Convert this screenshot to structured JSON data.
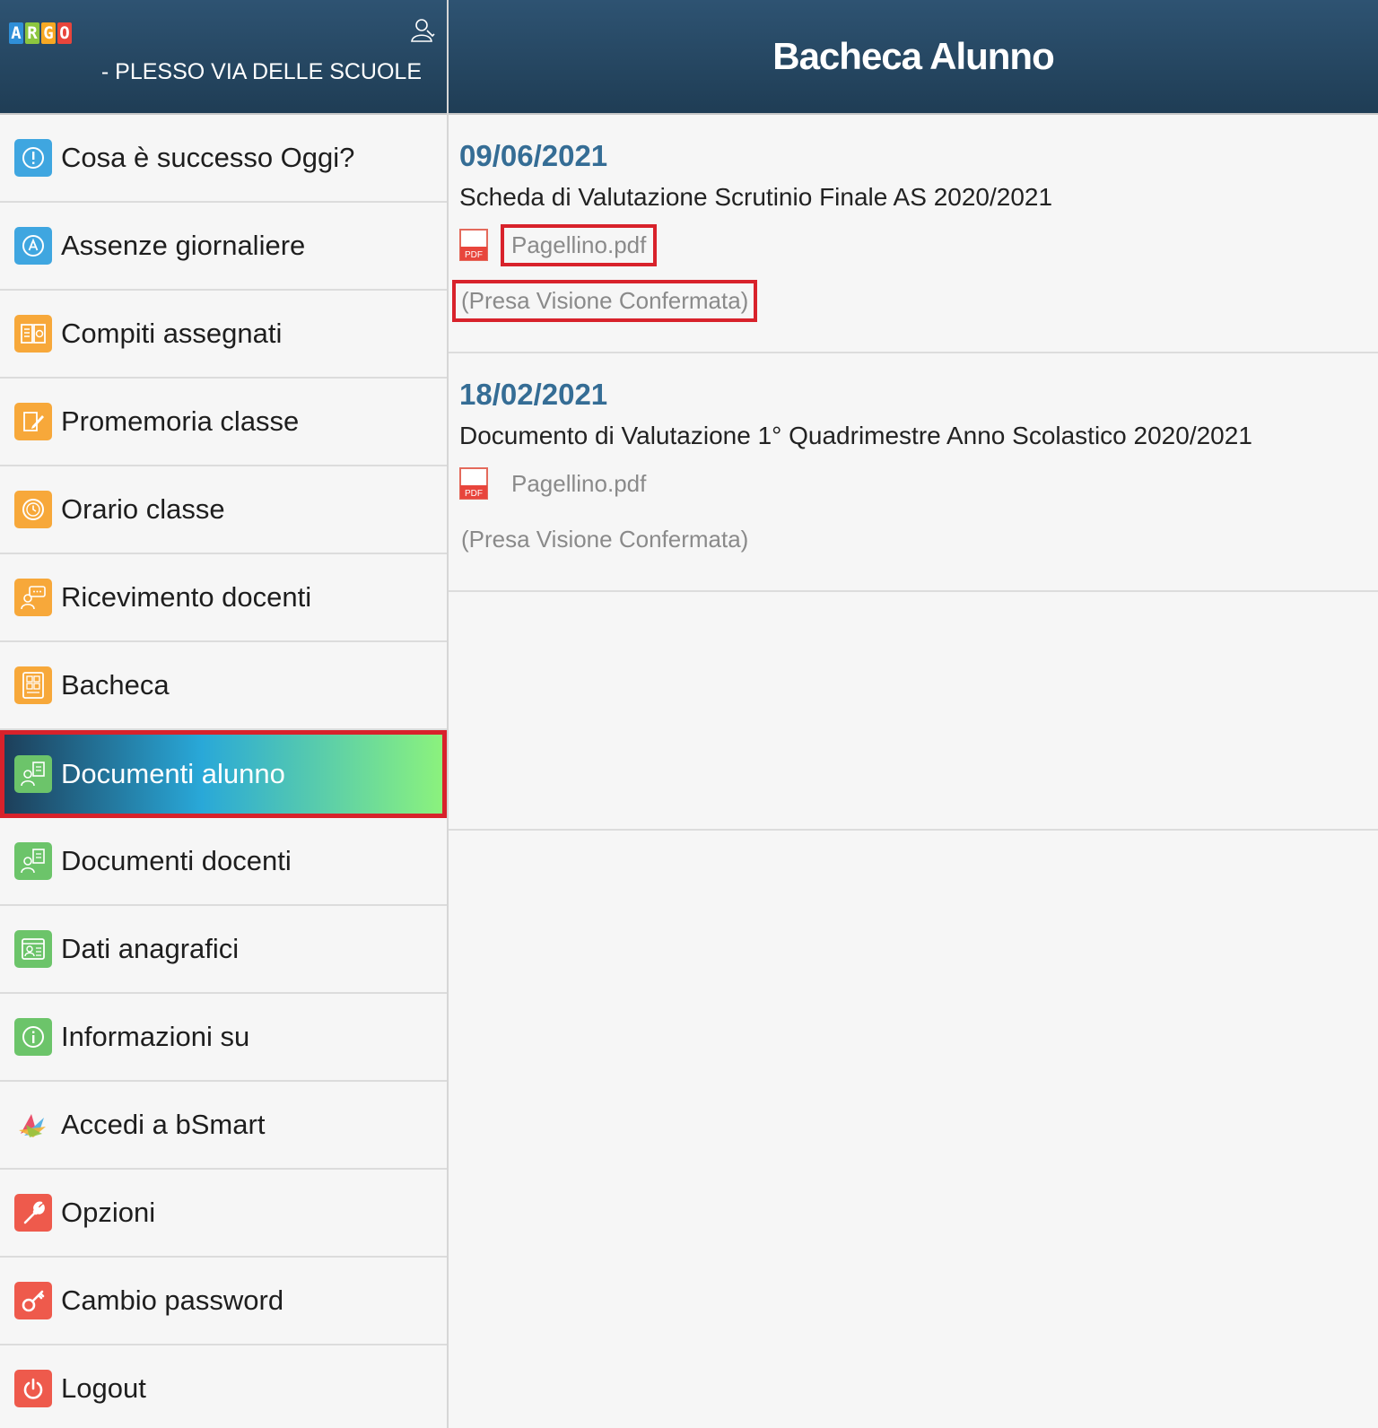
{
  "header": {
    "logo_letters": [
      "A",
      "R",
      "G",
      "O"
    ],
    "logo_colors": [
      "#2f8fd8",
      "#8cc63f",
      "#f7a823",
      "#e8453c"
    ],
    "school_name": "- PLESSO VIA DELLE SCUOLE",
    "title": "Bacheca Alunno"
  },
  "sidebar": {
    "items": [
      {
        "label": "Cosa è successo Oggi?",
        "icon": "exclamation-icon",
        "color": "#3fa6e0"
      },
      {
        "label": "Assenze giornaliere",
        "icon": "absence-icon",
        "color": "#3fa6e0"
      },
      {
        "label": "Compiti assegnati",
        "icon": "book-icon",
        "color": "#f7a83a"
      },
      {
        "label": "Promemoria classe",
        "icon": "note-pen-icon",
        "color": "#f7a83a"
      },
      {
        "label": "Orario classe",
        "icon": "clock-icon",
        "color": "#f7a83a"
      },
      {
        "label": "Ricevimento docenti",
        "icon": "teacher-chat-icon",
        "color": "#f7a83a"
      },
      {
        "label": "Bacheca",
        "icon": "board-icon",
        "color": "#f7a83a"
      },
      {
        "label": "Documenti alunno",
        "icon": "student-docs-icon",
        "color": "#6cc46a",
        "active": true
      },
      {
        "label": "Documenti docenti",
        "icon": "teacher-docs-icon",
        "color": "#6cc46a"
      },
      {
        "label": "Dati anagrafici",
        "icon": "id-card-icon",
        "color": "#6cc46a"
      },
      {
        "label": "Informazioni su",
        "icon": "info-icon",
        "color": "#6cc46a"
      },
      {
        "label": "Accedi a bSmart",
        "icon": "bsmart-icon",
        "color": "#e8553e"
      },
      {
        "label": "Opzioni",
        "icon": "wrench-icon",
        "color": "#ee5a4c"
      },
      {
        "label": "Cambio password",
        "icon": "key-icon",
        "color": "#ee5a4c"
      },
      {
        "label": "Logout",
        "icon": "power-icon",
        "color": "#ee5a4c"
      }
    ]
  },
  "documents": [
    {
      "date": "09/06/2021",
      "title": "Scheda di Valutazione Scrutinio Finale AS 2020/2021",
      "attachment": "Pagellino.pdf",
      "pdf_badge": "PDF",
      "status": "(Presa Visione Confermata)",
      "highlighted": true
    },
    {
      "date": "18/02/2021",
      "title": "Documento di Valutazione 1° Quadrimestre Anno Scolastico 2020/2021",
      "attachment": "Pagellino.pdf",
      "pdf_badge": "PDF",
      "status": "(Presa Visione Confermata)",
      "highlighted": false
    }
  ]
}
